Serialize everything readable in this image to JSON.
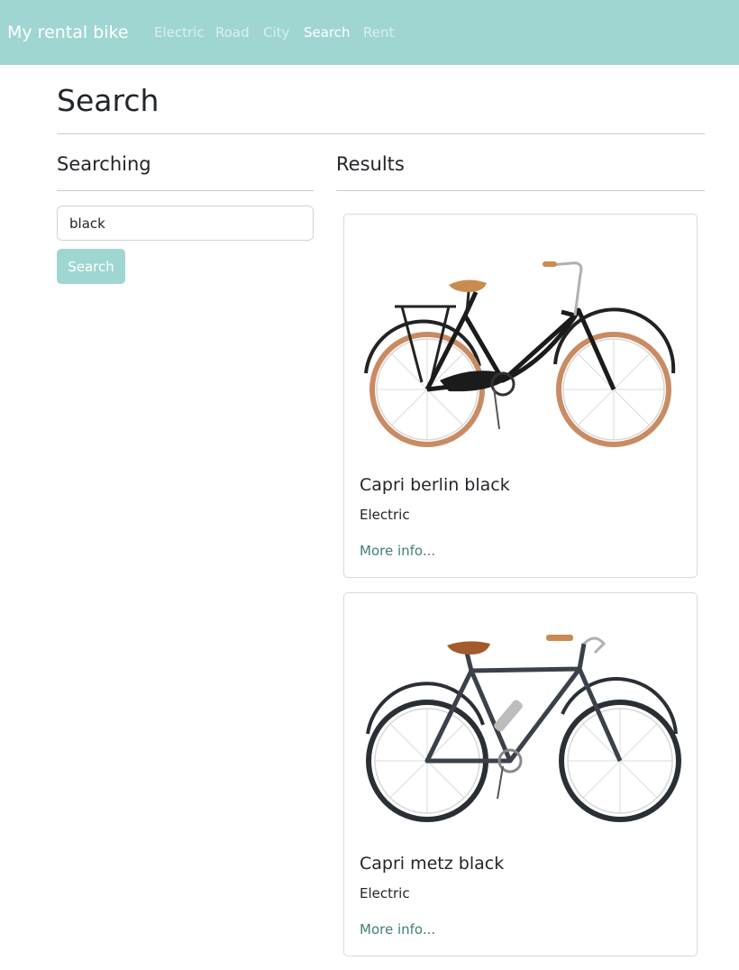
{
  "navbar": {
    "brand": "My rental bike",
    "links": [
      {
        "label": "Electric",
        "active": false
      },
      {
        "label": "Road",
        "active": false
      },
      {
        "label": "City",
        "active": false
      },
      {
        "label": "Search",
        "active": true
      },
      {
        "label": "Rent",
        "active": false
      }
    ]
  },
  "page": {
    "title": "Search"
  },
  "search_panel": {
    "title": "Searching",
    "input_value": "black",
    "button_label": "Search"
  },
  "results_panel": {
    "title": "Results",
    "items": [
      {
        "name": "Capri berlin black",
        "category": "Electric",
        "link_label": "More info...",
        "image": "step-through-black-bike-tan-tires"
      },
      {
        "name": "Capri metz black",
        "category": "Electric",
        "link_label": "More info...",
        "image": "dark-grey-diamond-frame-bike"
      }
    ]
  },
  "colors": {
    "primary": "#9fd6d2",
    "link": "#3f7f7b"
  }
}
